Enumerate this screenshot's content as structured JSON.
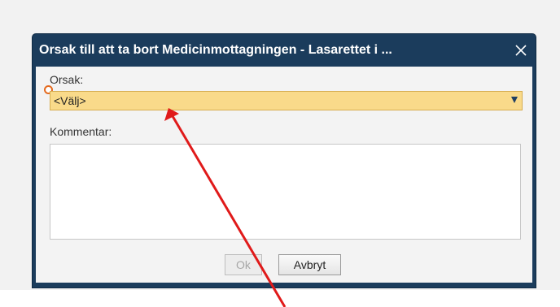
{
  "dialog": {
    "title": "Orsak till att ta bort Medicinmottagningen - Lasarettet i ...",
    "close_symbol": "✕",
    "reason_label": "Orsak:",
    "reason_selected": "<Välj>",
    "comment_label": "Kommentar:",
    "comment_value": "",
    "ok_label": "Ok",
    "cancel_label": "Avbryt"
  },
  "icons": {
    "close": "close-icon",
    "dropdown": "chevron-down-icon",
    "required": "required-marker-icon"
  },
  "colors": {
    "titlebar": "#1b3c5c",
    "select_background": "#f9da8a",
    "required_marker": "#e46a1f",
    "annotation_arrow": "#e01a1a"
  }
}
